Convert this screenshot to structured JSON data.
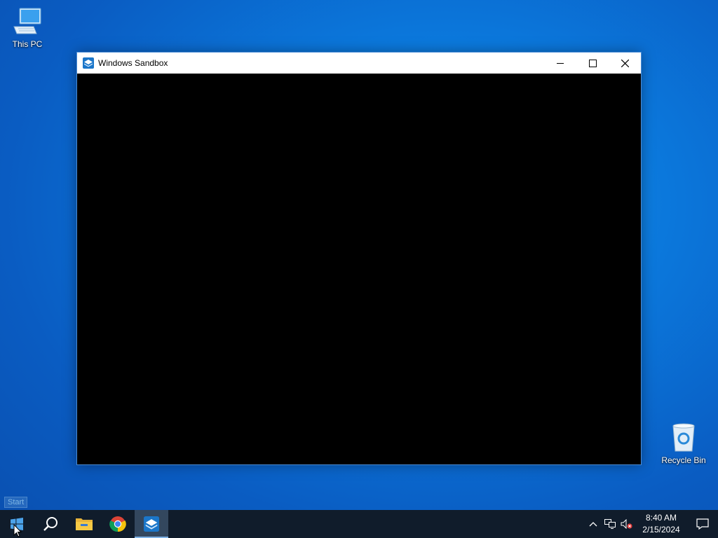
{
  "desktop": {
    "icons": [
      {
        "label": "This PC",
        "icon": "computer-icon"
      },
      {
        "label": "Recycle Bin",
        "icon": "recycle-bin-icon"
      }
    ]
  },
  "window": {
    "title": "Windows Sandbox",
    "app_icon": "windows-sandbox-icon",
    "controls": {
      "minimize": "minimize-icon",
      "maximize": "maximize-icon",
      "close": "close-icon"
    },
    "content_color": "#000000"
  },
  "tooltip": {
    "text": "Start"
  },
  "taskbar": {
    "buttons": [
      {
        "name": "start",
        "icon": "windows-logo-icon"
      },
      {
        "name": "search",
        "icon": "search-icon"
      },
      {
        "name": "file-explorer",
        "icon": "folder-icon"
      },
      {
        "name": "chrome",
        "icon": "chrome-icon"
      },
      {
        "name": "windows-sandbox",
        "icon": "windows-sandbox-icon",
        "active": true
      }
    ],
    "tray": {
      "icons": [
        "chevron-up-icon",
        "network-icon",
        "volume-muted-icon"
      ],
      "time": "8:40 AM",
      "date": "2/15/2024",
      "notification_icon": "notification-icon"
    }
  },
  "colors": {
    "desktop_accent": "#0b78dc",
    "taskbar_bg": "#101c2b",
    "active_task_bg": "#33475e"
  }
}
